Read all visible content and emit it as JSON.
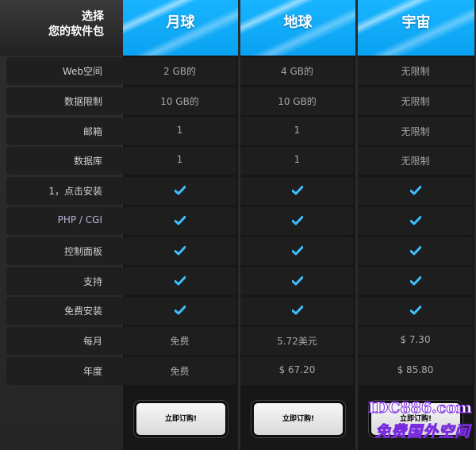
{
  "header": {
    "title_line1": "选择",
    "title_line2": "您的软件包"
  },
  "plans": [
    {
      "name": "月球",
      "values": [
        "2 GB的",
        "10 GB的",
        "1",
        "1",
        "check",
        "check",
        "check",
        "check",
        "check",
        "免费",
        "免费"
      ],
      "order_label": "立即订购!"
    },
    {
      "name": "地球",
      "values": [
        "4 GB的",
        "10 GB的",
        "1",
        "1",
        "check",
        "check",
        "check",
        "check",
        "check",
        "5.72美元",
        "$ 67.20"
      ],
      "order_label": "立即订购!"
    },
    {
      "name": "宇宙",
      "values": [
        "无限制",
        "无限制",
        "无限制",
        "无限制",
        "check",
        "check",
        "check",
        "check",
        "check",
        "$ 7.30",
        "$ 85.80"
      ],
      "order_label": "立即订购!"
    }
  ],
  "features": [
    "Web空间",
    "数据限制",
    "邮箱",
    "数据库",
    "1，点击安装",
    "PHP / CGI",
    "控制面板",
    "支持",
    "免费安装",
    "每月",
    "年度"
  ],
  "watermark": {
    "url": "IDC886.com",
    "text": "免费国外空间"
  },
  "colors": {
    "accent": "#17b0ff",
    "check": "#3fbfff"
  }
}
